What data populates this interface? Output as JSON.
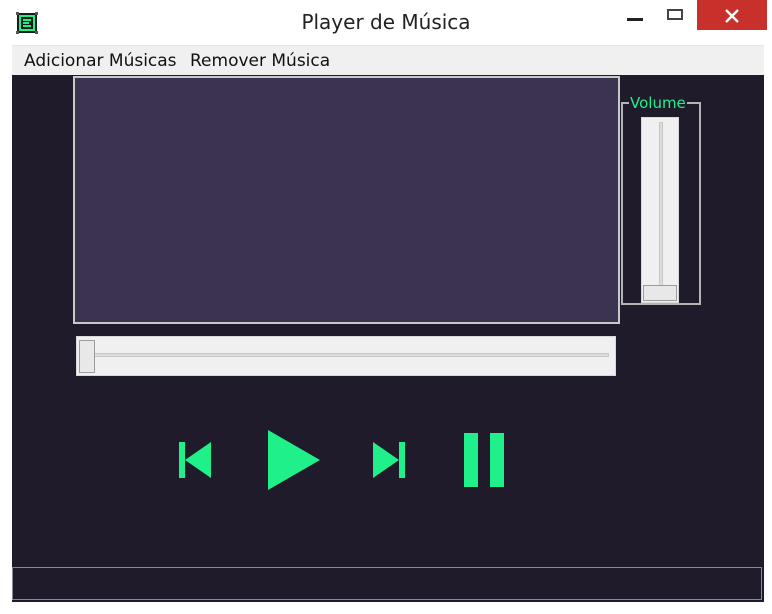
{
  "window": {
    "title": "Player de Música",
    "icon": "app-logo-icon",
    "controls": [
      "minimize-icon",
      "maximize-icon",
      "close-icon"
    ]
  },
  "menu": {
    "items": [
      {
        "label": "Adicionar Músicas"
      },
      {
        "label": "Remover Música"
      }
    ]
  },
  "volume": {
    "label": "Volume",
    "level": 0
  },
  "seek": {
    "position": 0
  },
  "controls": {
    "icons": [
      "previous-track-icon",
      "play-icon",
      "next-track-icon",
      "pause-icon"
    ]
  },
  "colors": {
    "accent": "#1ff08a",
    "background": "#1f1b2b",
    "video_panel": "#3c3252",
    "close_button": "#c7302b"
  }
}
